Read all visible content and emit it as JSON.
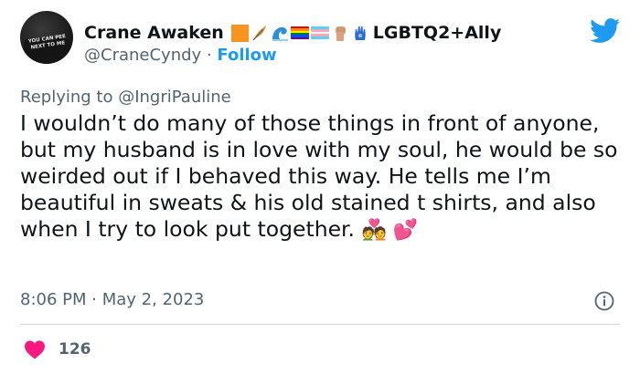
{
  "author": {
    "display_name": "Crane Awaken",
    "name_suffix": "LGBTQ2+Ally",
    "handle": "@CraneCyndy",
    "separator": "·",
    "follow_label": "Follow",
    "avatar_shirt_text": "YOU CAN PEE NEXT TO ME",
    "name_emojis": [
      "orange-square",
      "feather",
      "wave",
      "rainbow-flag",
      "transgender-flag",
      "raised-fist",
      "hamsa"
    ]
  },
  "reply": {
    "prefix": "Replying to",
    "target": "@IngriPauline"
  },
  "tweet": {
    "text": "I wouldn’t do many of those things in front of anyone, but my husband is in love with my soul, he would be so weirded out if I behaved this way. He tells me I’m beautiful in sweats & his old stained t shirts, and also when I try to look put together.",
    "emojis": "💑 💕",
    "time": "8:06 PM",
    "date": "May 2, 2023",
    "meta_separator": "·",
    "likes": "126"
  },
  "colors": {
    "brand_blue": "#1d9bf0",
    "heart_red": "#f91880",
    "muted": "#536471",
    "divider": "#cfd9de"
  }
}
